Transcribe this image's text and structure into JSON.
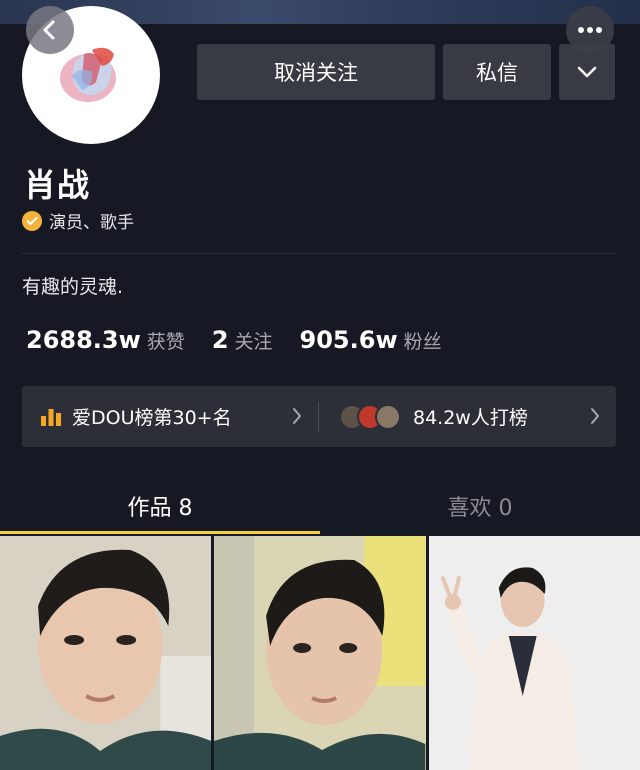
{
  "profile": {
    "name": "肖战",
    "verification": "演员、歌手",
    "bio": "有趣的灵魂."
  },
  "actions": {
    "unfollow_label": "取消关注",
    "message_label": "私信"
  },
  "stats": [
    {
      "value": "2688.3w",
      "label": "获赞"
    },
    {
      "value": "2",
      "label": "关注"
    },
    {
      "value": "905.6w",
      "label": "粉丝"
    }
  ],
  "ranking": {
    "rank_text": "爱DOU榜第30+名",
    "supporters_text": "84.2w人打榜"
  },
  "tabs": [
    {
      "label": "作品 8",
      "active": true
    },
    {
      "label": "喜欢 0",
      "active": false
    }
  ],
  "colors": {
    "background": "#161823",
    "button_bg": "#393b44",
    "accent_yellow": "#f5cf3a",
    "verify_badge": "#f6b33c"
  },
  "icons": [
    "back-icon",
    "more-icon",
    "chevron-down-icon",
    "verified-icon",
    "bar-chart-icon",
    "chevron-right-icon"
  ]
}
